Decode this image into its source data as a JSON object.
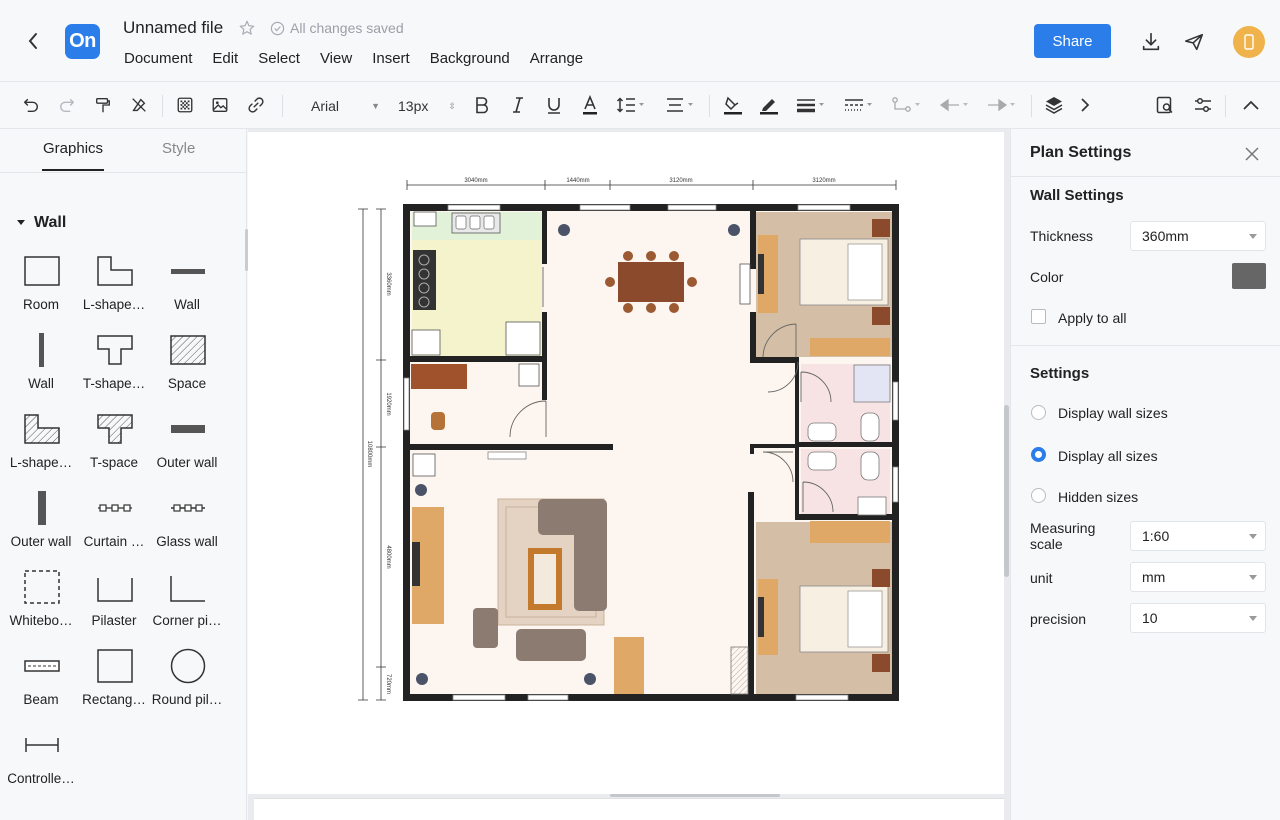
{
  "header": {
    "file_title": "Unnamed file",
    "save_status": "All changes saved",
    "logo_text": "On",
    "share_label": "Share",
    "menu": [
      "Document",
      "Edit",
      "Select",
      "View",
      "Insert",
      "Background",
      "Arrange"
    ]
  },
  "toolbar": {
    "font_family": "Arial",
    "font_size": "13px"
  },
  "sidebar": {
    "tabs": [
      "Graphics",
      "Style"
    ],
    "section": "Wall",
    "shapes": [
      "Room",
      "L-shape…",
      "Wall",
      "Wall",
      "T-shape…",
      "Space",
      "L-shape…",
      "T-space",
      "Outer wall",
      "Outer wall",
      "Curtain …",
      "Glass wall",
      "Whitebo…",
      "Pilaster",
      "Corner pi…",
      "Beam",
      "Rectang…",
      "Round pil…",
      "Controlle…"
    ]
  },
  "plan": {
    "dims_top": [
      "3040mm",
      "1440mm",
      "3120mm",
      "3120mm"
    ],
    "dims_left": [
      "3360mm",
      "1920mm",
      "4800mm",
      "720mm"
    ],
    "dim_total": "10800mm"
  },
  "panel": {
    "title": "Plan Settings",
    "wall_settings_title": "Wall Settings",
    "thickness_label": "Thickness",
    "thickness_value": "360mm",
    "color_label": "Color",
    "wall_color": "#666666",
    "apply_label": "Apply to all",
    "settings_title": "Settings",
    "radio_wall_sizes": "Display wall sizes",
    "radio_all_sizes": "Display all sizes",
    "radio_hidden": "Hidden sizes",
    "scale_label": "Measuring scale",
    "scale_value": "1:60",
    "unit_label": "unit",
    "unit_value": "mm",
    "precision_label": "precision",
    "precision_value": "10"
  },
  "colors": {
    "accent": "#2b7de9",
    "avatar": "#f0b24a",
    "floor": "#fdf5ef",
    "bedroom_floor": "#d4bfa6",
    "kitchen_floor": "#f5f3cc",
    "bathroom_floor": "#f7e3e3"
  }
}
